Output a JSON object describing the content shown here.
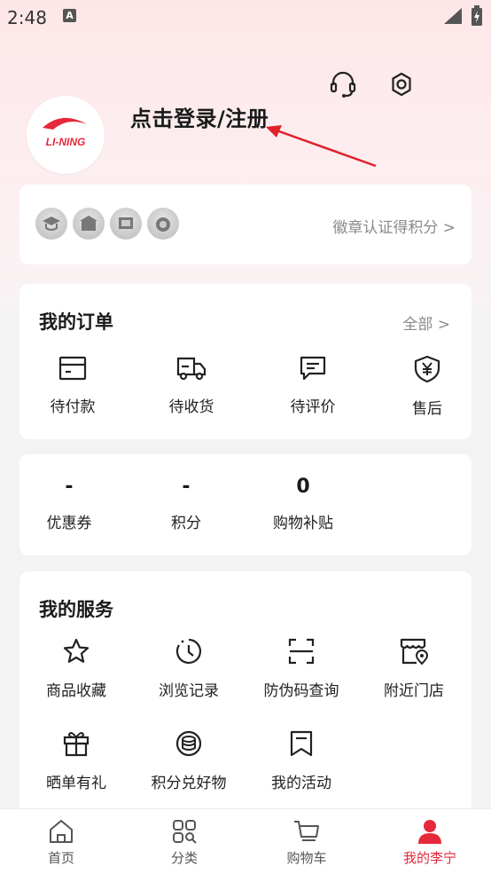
{
  "status_bar": {
    "time": "2:48",
    "notif_letter": "A"
  },
  "header": {
    "login_text": "点击登录/注册",
    "logo_text": "LI-NING"
  },
  "badges": {
    "link": "徽章认证得积分 >"
  },
  "orders": {
    "title": "我的订单",
    "all": "全部 >",
    "items": [
      {
        "label": "待付款",
        "icon": "wallet-icon"
      },
      {
        "label": "待收货",
        "icon": "truck-icon"
      },
      {
        "label": "待评价",
        "icon": "comment-icon"
      },
      {
        "label": "售后",
        "icon": "shield-yen-icon"
      }
    ]
  },
  "stats": [
    {
      "value": "-",
      "label": "优惠券"
    },
    {
      "value": "-",
      "label": "积分"
    },
    {
      "value": "0",
      "label": "购物补贴"
    }
  ],
  "services": {
    "title": "我的服务",
    "items": [
      {
        "label": "商品收藏",
        "icon": "star-icon"
      },
      {
        "label": "浏览记录",
        "icon": "clock-icon"
      },
      {
        "label": "防伪码查询",
        "icon": "scan-icon"
      },
      {
        "label": "附近门店",
        "icon": "store-icon"
      },
      {
        "label": "晒单有礼",
        "icon": "gift-icon"
      },
      {
        "label": "积分兑好物",
        "icon": "coins-icon"
      },
      {
        "label": "我的活动",
        "icon": "bookmark-icon"
      }
    ]
  },
  "tabbar": [
    {
      "label": "首页",
      "icon": "home-icon"
    },
    {
      "label": "分类",
      "icon": "category-icon"
    },
    {
      "label": "购物车",
      "icon": "cart-icon"
    },
    {
      "label": "我的李宁",
      "icon": "person-icon",
      "active": true
    }
  ],
  "colors": {
    "accent": "#e6283a",
    "hero_bg": "#fde6e8"
  }
}
